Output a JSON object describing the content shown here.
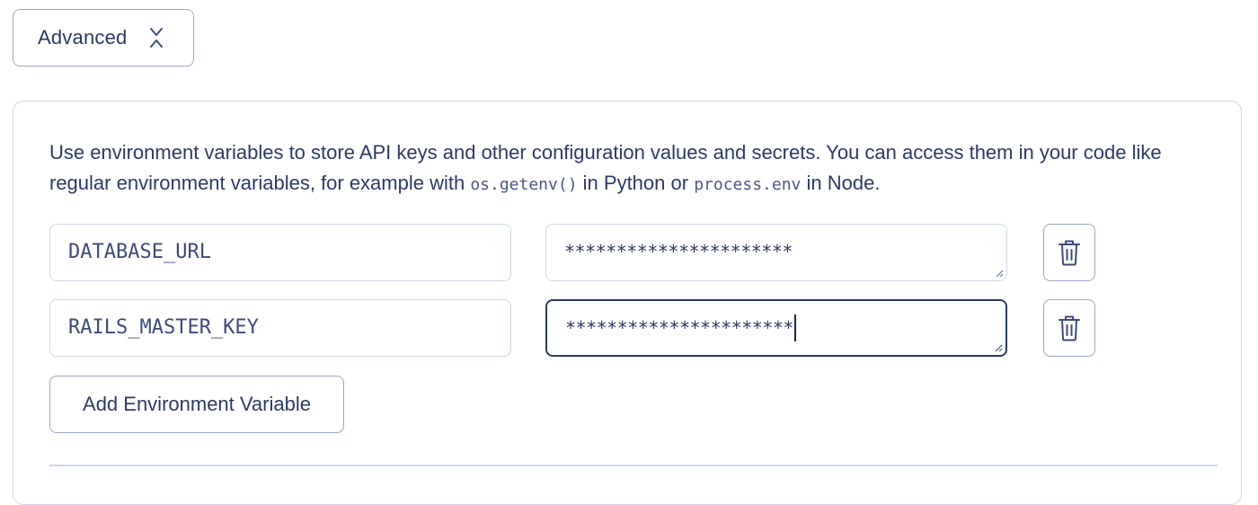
{
  "advanced": {
    "label": "Advanced",
    "icon": "chevrons-up-down-icon"
  },
  "panel": {
    "description": {
      "part1": "Use environment variables to store API keys and other configuration values and secrets. You can access them in your code like regular environment variables, for example with ",
      "code1": "os.getenv()",
      "part2": " in Python or ",
      "code2": "process.env",
      "part3": " in Node."
    },
    "env_vars": [
      {
        "key": "DATABASE_URL",
        "value": "**********************",
        "focused": false
      },
      {
        "key": "RAILS_MASTER_KEY",
        "value": "**********************",
        "focused": true
      }
    ],
    "add_button_label": "Add Environment Variable"
  },
  "colors": {
    "text": "#2c3a63",
    "border": "#cdd7ea",
    "button_border": "#9ba6c4",
    "focus_border": "#2c3a63"
  }
}
